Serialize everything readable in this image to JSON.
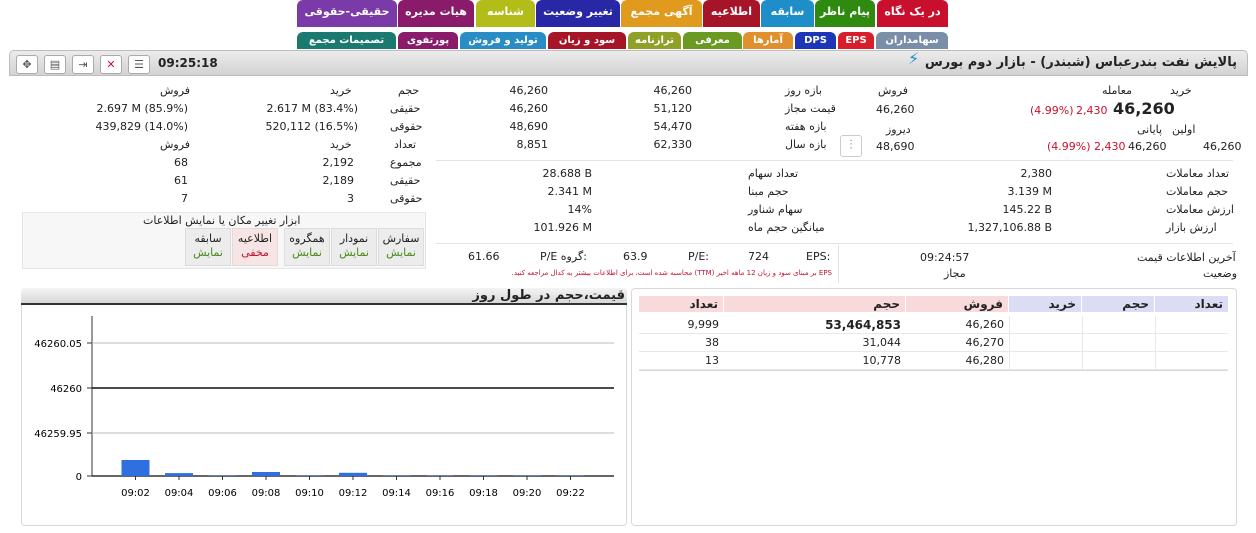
{
  "tabs_row1": [
    {
      "label": "در یک نگاه",
      "color": "#c8102e"
    },
    {
      "label": "پیام ناظر",
      "color": "#2e8b10"
    },
    {
      "label": "سابقه",
      "color": "#1e8ec9"
    },
    {
      "label": "اطلاعیه",
      "color": "#a61428"
    },
    {
      "label": "آگهی مجمع",
      "color": "#e09a1e"
    },
    {
      "label": "تغییر وضعیت",
      "color": "#2828a6"
    },
    {
      "label": "شناسه",
      "color": "#b3bd1a"
    },
    {
      "label": "هیات مدیره",
      "color": "#8a1a6a"
    },
    {
      "label": "حقیقی-حقوقی",
      "color": "#7a3aa8"
    }
  ],
  "tabs_row2": [
    {
      "label": "سهامداران",
      "color": "#7b8ea8"
    },
    {
      "label": "EPS",
      "color": "#d81e2a"
    },
    {
      "label": "DPS",
      "color": "#1d36b8"
    },
    {
      "label": "آمارها",
      "color": "#e0902e"
    },
    {
      "label": "معرفی",
      "color": "#6b9a22"
    },
    {
      "label": "ترازنامه",
      "color": "#8fa126"
    },
    {
      "label": "سود و زیان",
      "color": "#a61428"
    },
    {
      "label": "تولید و فروش",
      "color": "#2a8cc4"
    },
    {
      "label": "پورتفوی",
      "color": "#8a1a6a"
    },
    {
      "label": "تصمیمات مجمع",
      "color": "#1a7a70"
    }
  ],
  "header": {
    "title": "پالایش نفت بندرعباس (شبندر) - بازار دوم بورس",
    "time": "09:25:18"
  },
  "price_block": {
    "buy_label": "خرید",
    "trade_label": "معامله",
    "sell_label": "فروش",
    "last_price": "46,260",
    "last_change": "2,430",
    "last_pct": "(4.99%)",
    "sell_value": "46,260",
    "first_label": "اولین",
    "first_value": "46,260",
    "close_label": "پایانی",
    "close_price": "46,260",
    "close_change": "2,430",
    "close_pct": "(4.99%)",
    "yesterday_label": "دیروز",
    "yesterday_value": "48,690"
  },
  "ranges": [
    {
      "label": "بازه روز",
      "low": "46,260",
      "high": "46,260"
    },
    {
      "label": "قیمت مجاز",
      "low": "51,120",
      "high": "46,260"
    },
    {
      "label": "بازه هفته",
      "low": "54,470",
      "high": "48,690"
    },
    {
      "label": "بازه سال",
      "low": "62,330",
      "high": "8,851"
    }
  ],
  "trade_stats": [
    {
      "label": "تعداد معاملات",
      "value": "2,380"
    },
    {
      "label": "حجم معاملات",
      "value": "3.139 M"
    },
    {
      "label": "ارزش معاملات",
      "value": "145.22 B"
    },
    {
      "label": "ارزش بازار",
      "value": "1,327,106.88 B"
    }
  ],
  "share_stats": [
    {
      "label": "تعداد سهام",
      "value": "28.688 B"
    },
    {
      "label": "حجم مبنا",
      "value": "2.341 M"
    },
    {
      "label": "سهام شناور",
      "value": "14%"
    },
    {
      "label": "میانگین حجم ماه",
      "value": "101.926 M"
    }
  ],
  "last_info": {
    "label": "آخرین اطلاعات قیمت",
    "time": "09:24:57",
    "status_label": "وضعیت",
    "status_value": "مجاز"
  },
  "eps": {
    "eps_label": "EPS:",
    "eps_value": "724",
    "pe_label": "P/E:",
    "pe_value": "63.9",
    "gpe_label": "P/E گروه:",
    "gpe_value": "61.66",
    "note": "EPS بر مبنای سود و زیان 12 ماهه اخیر (TTM) محاسبه شده است، برای اطلاعات بیشتر به کدال مراجعه کنید."
  },
  "individual": {
    "h_vol": "حجم",
    "h_buy": "خرید",
    "h_sell": "فروش",
    "rows_vol": [
      {
        "label": "حقیقی",
        "buy": "2.617 M (83.4%)",
        "sell": "2.697 M (85.9%)"
      },
      {
        "label": "حقوقی",
        "buy": "520,112 (16.5%)",
        "sell": "439,829 (14.0%)"
      }
    ],
    "h_count": "تعداد",
    "h_buy2": "خرید",
    "h_sell2": "فروش",
    "rows_count": [
      {
        "label": "مجموع",
        "buy": "2,192",
        "sell": "68"
      },
      {
        "label": "حقیقی",
        "buy": "2,189",
        "sell": "61"
      },
      {
        "label": "حقوقی",
        "buy": "3",
        "sell": "7"
      }
    ]
  },
  "tool": {
    "title": "ابزار تغییر مکان یا نمایش اطلاعات",
    "items": [
      {
        "name": "سفارش",
        "state": "نمایش",
        "hidden": false
      },
      {
        "name": "نمودار",
        "state": "نمایش",
        "hidden": false
      },
      {
        "name": "همگروه",
        "state": "نمایش",
        "hidden": false
      },
      {
        "name": "اطلاعیه",
        "state": "مخفی",
        "hidden": true
      },
      {
        "name": "سابقه",
        "state": "نمایش",
        "hidden": false
      }
    ]
  },
  "orderbook": {
    "headers": [
      "تعداد",
      "حجم",
      "خرید",
      "فروش",
      "حجم",
      "تعداد"
    ],
    "rows": [
      {
        "sell_price": "46,260",
        "sell_vol": "53,464,853",
        "sell_count": "9,999",
        "bold": true
      },
      {
        "sell_price": "46,270",
        "sell_vol": "31,044",
        "sell_count": "38",
        "bold": false
      },
      {
        "sell_price": "46,280",
        "sell_vol": "10,778",
        "sell_count": "13",
        "bold": false
      }
    ]
  },
  "chart_title": "قیمت،حجم در طول روز",
  "chart_data": {
    "type": "line",
    "title": "قیمت،حجم در طول روز",
    "y_ticks": [
      "46260.05",
      "46260",
      "46259.95"
    ],
    "ylim": [
      46259.92,
      46260.08
    ],
    "x_ticks": [
      "09:02",
      "09:04",
      "09:06",
      "09:08",
      "09:10",
      "09:12",
      "09:14",
      "09:16",
      "09:18",
      "09:20",
      "09:22"
    ],
    "price_series": {
      "x": [
        "09:00",
        "09:24"
      ],
      "y": [
        46260,
        46260
      ]
    },
    "volume_ticks": [
      "0"
    ],
    "volume_series": {
      "x": [
        "09:02",
        "09:04",
        "09:06",
        "09:08",
        "09:10",
        "09:12",
        "09:14",
        "09:16",
        "09:18",
        "09:20",
        "09:22"
      ],
      "y": [
        1.0,
        0.18,
        0.03,
        0.25,
        0.03,
        0.2,
        0.03,
        0.03,
        0.03,
        0.03,
        0.03
      ]
    }
  }
}
